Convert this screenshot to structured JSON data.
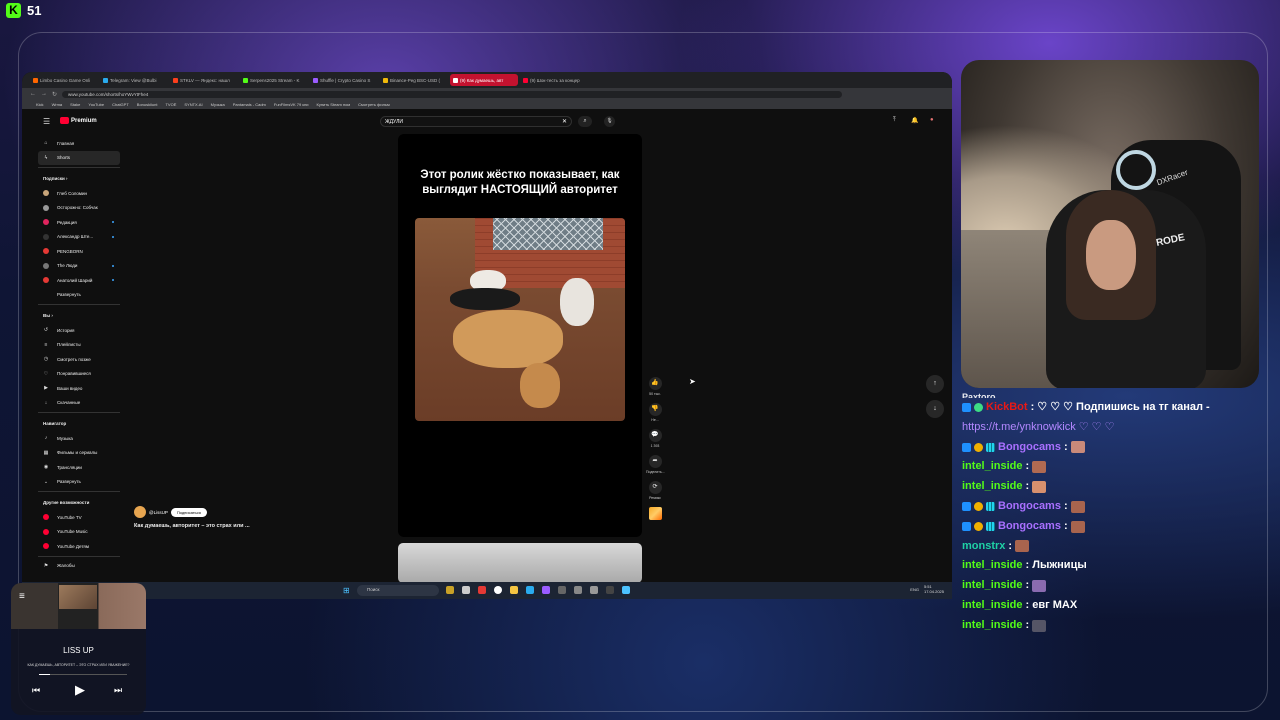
{
  "overlay": {
    "kick_logo": "K",
    "viewer_count": "51",
    "accent": "#53fc18"
  },
  "browser": {
    "tabs": [
      {
        "label": "Limbo Casino Game Onli",
        "active": false,
        "color": "#ff6600"
      },
      {
        "label": "Telegram: View @Bulbi",
        "active": false,
        "color": "#2aabee"
      },
      {
        "label": "STKLV — Яндекс: нашл",
        "active": false,
        "color": "#fc3f1d"
      },
      {
        "label": "Serpens2025 Stream - K",
        "active": false,
        "color": "#53fc18"
      },
      {
        "label": "Shuffle | Crypto Casino S",
        "active": false,
        "color": "#9b5cff"
      },
      {
        "label": "Binance-Peg BSC-USD (",
        "active": false,
        "color": "#f0b90b"
      },
      {
        "label": "(9) Как думаешь, авт",
        "active": true,
        "color": "#ffffff"
      },
      {
        "label": "(9) Шок-тесть за концер",
        "active": false,
        "color": "#ff0033"
      }
    ],
    "url": "www.youtube.com/shorts/hoYWvYtFhe4",
    "bookmarks": [
      "Kick",
      "Wrma",
      "Stake",
      "YouTube",
      "ChatGPT",
      "Bonuskiiunt",
      "TVOË",
      "SYNTX.AI",
      "Музыка",
      "Pantamals - Cadm",
      "FunFilmsVK 79 кни",
      "Купить Steam пом",
      "Смотреть фильм"
    ]
  },
  "youtube": {
    "menu_icon": "☰",
    "logo_text": "Premium",
    "search_value": "ЖДУЛИ",
    "search_clear": "✕",
    "search_icon": "⌕",
    "mic_icon": "🎙",
    "top_icons": [
      "⤒",
      "🔔",
      "●"
    ],
    "sidebar": {
      "main": [
        {
          "label": "Главная",
          "icon": "⌂"
        },
        {
          "label": "Shorts",
          "icon": "ϟ"
        }
      ],
      "subs_heading": "Подписки  ›",
      "subs": [
        {
          "label": "Глеб Соломин",
          "color": "#c8a57a",
          "dot": false
        },
        {
          "label": "Осторожно: Собчак",
          "color": "#999999",
          "dot": false
        },
        {
          "label": "Редакция",
          "color": "#e0245e",
          "dot": true
        },
        {
          "label": "Александр Ште...",
          "color": "#333333",
          "dot": true
        },
        {
          "label": "PENGBORN",
          "color": "#e53935",
          "dot": false
        },
        {
          "label": "The Люди",
          "color": "#777777",
          "dot": true
        },
        {
          "label": "Анатолий Шарий",
          "color": "#e53935",
          "dot": true
        },
        {
          "label": "Развернуть",
          "color": "",
          "dot": false
        }
      ],
      "you_heading": "Вы  ›",
      "you": [
        {
          "label": "История",
          "icon": "↺"
        },
        {
          "label": "Плейлисты",
          "icon": "≡"
        },
        {
          "label": "Смотреть позже",
          "icon": "◷"
        },
        {
          "label": "Понравившиеся",
          "icon": "♡"
        },
        {
          "label": "Ваши видео",
          "icon": "▶"
        },
        {
          "label": "Скачанные",
          "icon": "↓"
        }
      ],
      "nav_heading": "Навигатор",
      "nav": [
        {
          "label": "Музыка",
          "icon": "♪"
        },
        {
          "label": "Фильмы и сериалы",
          "icon": "▦"
        },
        {
          "label": "Трансляции",
          "icon": "◉"
        },
        {
          "label": "Развернуть",
          "icon": "⌄"
        }
      ],
      "other_heading": "Другие возможности",
      "other": [
        {
          "label": "YouTube TV",
          "color": "#ff0033"
        },
        {
          "label": "YouTube Music",
          "color": "#ff0033"
        },
        {
          "label": "YouTube Детям",
          "color": "#ff0033"
        }
      ],
      "complaints": "Жалобы"
    },
    "short": {
      "caption": "Этот ролик жёстко показывает, как выглядит НАСТОЯЩИЙ авторитет",
      "channel": "@LissUP",
      "subscribe": "Подписаться",
      "title": "Как думаешь, авторитет – это страх или ...",
      "actions": [
        {
          "icon": "👍",
          "label": "50 тыс."
        },
        {
          "icon": "👎",
          "label": "Не..."
        },
        {
          "icon": "💬",
          "label": "1 393"
        },
        {
          "icon": "➦",
          "label": "Поделить..."
        },
        {
          "icon": "⟳",
          "label": "Ремикс"
        }
      ]
    },
    "nav_up": "↑",
    "nav_down": "↓",
    "cursor": "➤"
  },
  "taskbar": {
    "win_icon": "⊞",
    "search_placeholder": "Поиск",
    "lang": "ENG",
    "time": "5:51",
    "date": "17.04.2025"
  },
  "chat": {
    "partial_line": "Paxtoro",
    "messages": [
      {
        "user": "KickBot",
        "class": "user-red",
        "badges": [
          "b-blue",
          "b-green"
        ],
        "text": ": ♡ ♡ ♡ Подпишись на тг канал -",
        "emote": ""
      },
      {
        "user": "",
        "class": "",
        "badges": [],
        "text": "",
        "link": "https://t.me/ynknowkick ♡ ♡ ♡",
        "emote": ""
      },
      {
        "user": "Bongocams",
        "class": "user-purple",
        "badges": [
          "b-blue",
          "b-gold",
          "b-grid"
        ],
        "text": " :",
        "emote": "#c98a7a"
      },
      {
        "user": "intel_inside",
        "class": "user-green",
        "badges": [],
        "text": " :",
        "emote": "#b06a52"
      },
      {
        "user": "intel_inside",
        "class": "user-green",
        "badges": [],
        "text": " :",
        "emote": "#d7906e"
      },
      {
        "user": "Bongocams",
        "class": "user-purple",
        "badges": [
          "b-blue",
          "b-gold",
          "b-grid"
        ],
        "text": " :",
        "emote": "#a8644e"
      },
      {
        "user": "Bongocams",
        "class": "user-purple",
        "badges": [
          "b-blue",
          "b-gold",
          "b-grid"
        ],
        "text": " :",
        "emote": "#a8644e"
      },
      {
        "user": "monstrx",
        "class": "user-teal",
        "badges": [],
        "text": " :",
        "emote": "#a8644e"
      },
      {
        "user": "intel_inside",
        "class": "user-green",
        "badges": [],
        "text": " : Лыжницы",
        "emote": ""
      },
      {
        "user": "intel_inside",
        "class": "user-green",
        "badges": [],
        "text": " :",
        "emote": "#8a6bb0"
      },
      {
        "user": "intel_inside",
        "class": "user-green",
        "badges": [],
        "text": " : евг MAX",
        "emote": ""
      },
      {
        "user": "intel_inside",
        "class": "user-green",
        "badges": [],
        "text": " :",
        "emote": "#555566"
      }
    ]
  },
  "webcam": {
    "brand": "RODE",
    "brand2": "DXRacer"
  },
  "player": {
    "eq_icon": "≡",
    "artist": "LISS UP",
    "title": "КАК ДУМАЕШЬ, АВТОРИТЕТ – ЭТО СТРАХ ИЛИ УВАЖЕНИЕ?",
    "progress": 0.12,
    "prev": "⏮",
    "play": "▶",
    "next": "⏭"
  }
}
